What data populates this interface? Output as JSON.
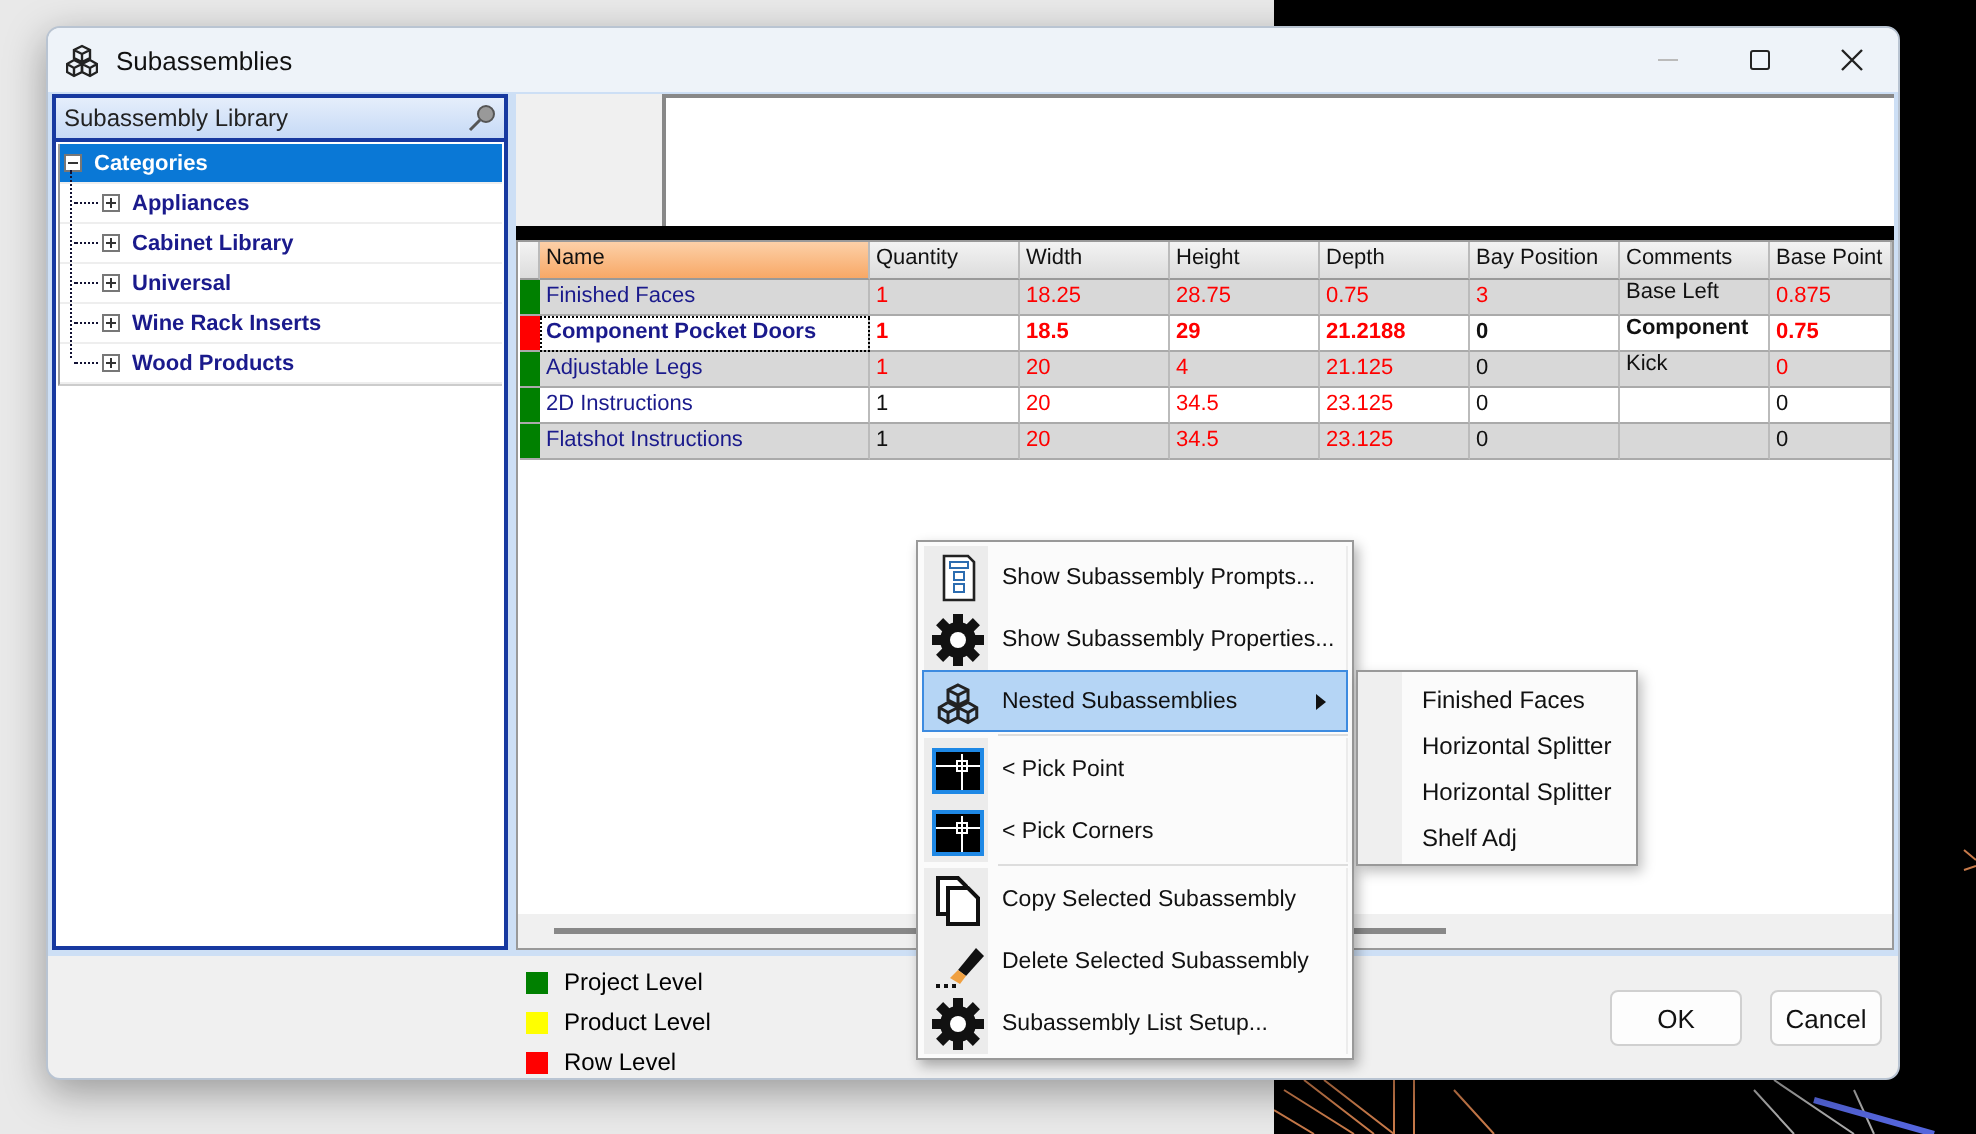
{
  "window": {
    "title": "Subassemblies"
  },
  "library": {
    "title": "Subassembly Library",
    "tree": [
      {
        "label": "Categories",
        "selected": true,
        "expanded": true,
        "children": [
          {
            "label": "Appliances",
            "selected": false,
            "expanded": false
          },
          {
            "label": "Cabinet Library",
            "selected": false,
            "expanded": false
          },
          {
            "label": "Universal",
            "selected": false,
            "expanded": false
          },
          {
            "label": "Wine Rack Inserts",
            "selected": false,
            "expanded": false
          },
          {
            "label": "Wood Products",
            "selected": false,
            "expanded": false
          }
        ]
      }
    ]
  },
  "table": {
    "columns": [
      {
        "label": "Name",
        "sorted": true
      },
      {
        "label": "Quantity",
        "sorted": false
      },
      {
        "label": "Width",
        "sorted": false
      },
      {
        "label": "Height",
        "sorted": false
      },
      {
        "label": "Depth",
        "sorted": false
      },
      {
        "label": "Bay Position",
        "sorted": false
      },
      {
        "label": "Comments",
        "sorted": false
      },
      {
        "label": "Base Point",
        "sorted": false
      }
    ],
    "rows": [
      {
        "color": "#008000",
        "selected": false,
        "cells": [
          {
            "text": "Finished Faces"
          },
          {
            "text": "1",
            "red": true
          },
          {
            "text": "18.25",
            "red": true
          },
          {
            "text": "28.75",
            "red": true
          },
          {
            "text": "0.75",
            "red": true
          },
          {
            "text": "3",
            "red": true
          },
          {
            "text": "Base Left",
            "red": false
          },
          {
            "text": "0.875",
            "red": true
          }
        ]
      },
      {
        "color": "#ff0000",
        "selected": true,
        "cells": [
          {
            "text": "Component Pocket Doors"
          },
          {
            "text": "1",
            "red": true
          },
          {
            "text": "18.5",
            "red": true
          },
          {
            "text": "29",
            "red": true
          },
          {
            "text": "21.2188",
            "red": true
          },
          {
            "text": "0",
            "red": false
          },
          {
            "text": "Component",
            "red": false
          },
          {
            "text": "0.75",
            "red": true
          }
        ]
      },
      {
        "color": "#008000",
        "selected": false,
        "cells": [
          {
            "text": "Adjustable Legs"
          },
          {
            "text": "1",
            "red": true
          },
          {
            "text": "20",
            "red": true
          },
          {
            "text": "4",
            "red": true
          },
          {
            "text": "21.125",
            "red": true
          },
          {
            "text": "0",
            "red": false
          },
          {
            "text": "Kick",
            "red": false
          },
          {
            "text": "0",
            "red": true
          }
        ]
      },
      {
        "color": "#008000",
        "selected": false,
        "cells": [
          {
            "text": "2D Instructions"
          },
          {
            "text": "1",
            "red": false
          },
          {
            "text": "20",
            "red": true
          },
          {
            "text": "34.5",
            "red": true
          },
          {
            "text": "23.125",
            "red": true
          },
          {
            "text": "0",
            "red": false
          },
          null,
          {
            "text": "0",
            "red": false
          }
        ]
      },
      {
        "color": "#008000",
        "selected": false,
        "cells": [
          {
            "text": "Flatshot Instructions"
          },
          {
            "text": "1",
            "red": false
          },
          {
            "text": "20",
            "red": true
          },
          {
            "text": "34.5",
            "red": true
          },
          {
            "text": "23.125",
            "red": true
          },
          {
            "text": "0",
            "red": false
          },
          null,
          {
            "text": "0",
            "red": false
          }
        ]
      }
    ]
  },
  "legend": [
    {
      "label": "Project Level",
      "color": "#008000"
    },
    {
      "label": "Product Level",
      "color": "#ffff00"
    },
    {
      "label": "Row Level",
      "color": "#ff0000"
    }
  ],
  "buttons": [
    "OK",
    "Cancel"
  ],
  "context_menu": {
    "groups": [
      [
        {
          "label": "Show Subassembly Prompts...",
          "selected": false,
          "submenu": false
        },
        {
          "label": "Show Subassembly Properties...",
          "selected": false,
          "submenu": false
        },
        {
          "label": "Nested Subassemblies",
          "selected": true,
          "submenu": true
        }
      ],
      [
        {
          "label": "< Pick Point",
          "selected": false,
          "submenu": false
        },
        {
          "label": "< Pick Corners",
          "selected": false,
          "submenu": false
        }
      ],
      [
        {
          "label": "Copy Selected Subassembly",
          "selected": false,
          "submenu": false
        },
        {
          "label": "Delete Selected Subassembly",
          "selected": false,
          "submenu": false
        },
        {
          "label": "Subassembly List Setup...",
          "selected": false,
          "submenu": false
        }
      ]
    ],
    "submenu": [
      "Finished Faces",
      "Horizontal Splitter",
      "Horizontal Splitter",
      "Shelf Adj"
    ]
  }
}
